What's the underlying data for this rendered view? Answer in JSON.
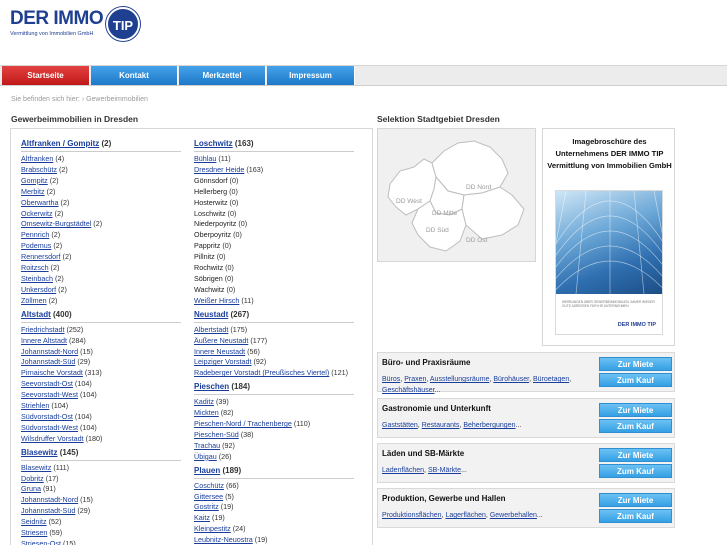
{
  "logo": {
    "name": "DER IMMO",
    "badge": "TIP",
    "tagline": "Vermittlung von Immobilien GmbH"
  },
  "nav": [
    "Startseite",
    "Kontakt",
    "Merkzettel",
    "Impressum"
  ],
  "breadcrumb": "Sie befinden sich hier:  ›  Gewerbeimmobilien",
  "left": {
    "title": "Gewerbeimmobilien in Dresden",
    "col1": [
      {
        "name": "Altfranken / Gompitz",
        "count": "(2)",
        "items": [
          [
            "Altfranken",
            "(4)",
            true
          ],
          [
            "Brabschütz",
            "(2)",
            true
          ],
          [
            "Gompitz",
            "(2)",
            true
          ],
          [
            "Merbitz",
            "(2)",
            true
          ],
          [
            "Oberwartha",
            "(2)",
            true
          ],
          [
            "Ockerwitz",
            "(2)",
            true
          ],
          [
            "Omsewitz-Burgstädtel",
            "(2)",
            true
          ],
          [
            "Pennrich",
            "(2)",
            true
          ],
          [
            "Podemus",
            "(2)",
            true
          ],
          [
            "Rennersdorf",
            "(2)",
            true
          ],
          [
            "Roitzsch",
            "(2)",
            true
          ],
          [
            "Steinbach",
            "(2)",
            true
          ],
          [
            "Unkersdorf",
            "(2)",
            true
          ],
          [
            "Zöllmen",
            "(2)",
            true
          ]
        ]
      },
      {
        "name": "Altstadt",
        "count": "(400)",
        "items": [
          [
            "Friedrichstadt",
            "(252)",
            true
          ],
          [
            "Innere Altstadt",
            "(284)",
            true
          ],
          [
            "Johannstadt-Nord",
            "(15)",
            true
          ],
          [
            "Johannstadt-Süd",
            "(29)",
            true
          ],
          [
            "Pirnaische Vorstadt",
            "(313)",
            true
          ],
          [
            "Seevorstadt-Ost",
            "(104)",
            true
          ],
          [
            "Seevorstadt-West",
            "(104)",
            true
          ],
          [
            "Striehlen",
            "(104)",
            true
          ],
          [
            "Südvorstadt-Ost",
            "(104)",
            true
          ],
          [
            "Südvorstadt-West",
            "(104)",
            true
          ],
          [
            "Wilsdruffer Vorstadt",
            "(180)",
            true
          ]
        ]
      },
      {
        "name": "Blasewitz",
        "count": "(145)",
        "items": [
          [
            "Blasewitz",
            "(111)",
            true
          ],
          [
            "Dobritz",
            "(17)",
            true
          ],
          [
            "Gruna",
            "(91)",
            true
          ],
          [
            "Johannstadt-Nord",
            "(15)",
            true
          ],
          [
            "Johannstadt-Süd",
            "(29)",
            true
          ],
          [
            "Seidnitz",
            "(52)",
            true
          ],
          [
            "Striesen",
            "(59)",
            true
          ],
          [
            "Striesen-Ost",
            "(15)",
            true
          ]
        ]
      }
    ],
    "col2": [
      {
        "name": "Loschwitz",
        "count": "(163)",
        "items": [
          [
            "Bühlau",
            "(11)",
            true
          ],
          [
            "Dresdner Heide",
            "(163)",
            true
          ],
          [
            "Gönnsdorf",
            "(0)",
            false
          ],
          [
            "Hellerberg",
            "(0)",
            false
          ],
          [
            "Hosterwitz",
            "(0)",
            false
          ],
          [
            "Loschwitz",
            "(0)",
            false
          ],
          [
            "Niederpoyritz",
            "(0)",
            false
          ],
          [
            "Oberpoyritz",
            "(0)",
            false
          ],
          [
            "Pappritz",
            "(0)",
            false
          ],
          [
            "Pillnitz",
            "(0)",
            false
          ],
          [
            "Rochwitz",
            "(0)",
            false
          ],
          [
            "Söbrigen",
            "(0)",
            false
          ],
          [
            "Wachwitz",
            "(0)",
            false
          ],
          [
            "Weißer Hirsch",
            "(11)",
            true
          ]
        ]
      },
      {
        "name": "Neustadt",
        "count": "(267)",
        "items": [
          [
            "Albertstadt",
            "(175)",
            true
          ],
          [
            "Äußere Neustadt",
            "(177)",
            true
          ],
          [
            "Innere Neustadt",
            "(56)",
            true
          ],
          [
            "Leipziger Vorstadt",
            "(92)",
            true
          ],
          [
            "Radeberger Vorstadt (Preußisches Viertel)",
            "(121)",
            true
          ]
        ]
      },
      {
        "name": "Pieschen",
        "count": "(184)",
        "items": [
          [
            "Kaditz",
            "(39)",
            true
          ],
          [
            "Mickten",
            "(82)",
            true
          ],
          [
            "Pieschen-Nord / Trachenberge",
            "(110)",
            true
          ],
          [
            "Pieschen-Süd",
            "(38)",
            true
          ],
          [
            "Trachau",
            "(92)",
            true
          ],
          [
            "Übigau",
            "(26)",
            true
          ]
        ]
      },
      {
        "name": "Plauen",
        "count": "(189)",
        "items": [
          [
            "Coschütz",
            "(66)",
            true
          ],
          [
            "Gittersee",
            "(5)",
            true
          ],
          [
            "Gostritz",
            "(19)",
            true
          ],
          [
            "Kaitz",
            "(19)",
            true
          ],
          [
            "Kleinpestitz",
            "(24)",
            true
          ],
          [
            "Leubnitz-Neuostra",
            "(19)",
            true
          ]
        ]
      }
    ]
  },
  "map": {
    "title": "Selektion Stadtgebiet Dresden",
    "labels": {
      "nord": "DD Nord",
      "west": "DD West",
      "mitte": "DD Mitte",
      "sued": "DD Süd",
      "ost": "DD Ost"
    }
  },
  "brochure": {
    "title": "Imagebroschüre des Unternehmens DER IMMO TIP Vermittlung von Immobilien GmbH",
    "cover_text": "WERBUNGEN ÜBER GEWERBEIMMOBILIEN. IMMER WIEDER GUTE ADRESSEN FÜR IHR UNTERNEHMEN",
    "cover_logo": "DER IMMO TIP"
  },
  "categories": [
    {
      "title": "Büro- und Praxisräume",
      "links": [
        "Büros",
        "Praxen",
        "Ausstellungsräume",
        "Bürohäuser",
        "Büroetagen",
        "Geschäftshäuser"
      ],
      "rent": "Zur Miete",
      "buy": "Zum Kauf"
    },
    {
      "title": "Gastronomie und Unterkunft",
      "links": [
        "Gaststätten",
        "Restaurants",
        "Beherbergungen"
      ],
      "rent": "Zur Miete",
      "buy": "Zum Kauf"
    },
    {
      "title": "Läden und SB-Märkte",
      "links": [
        "Ladenflächen",
        "SB-Märkte"
      ],
      "rent": "Zur Miete",
      "buy": "Zum Kauf"
    },
    {
      "title": "Produktion, Gewerbe und Hallen",
      "links": [
        "Produktionsflächen",
        "Lagerflächen",
        "Gewerbehallen"
      ],
      "rent": "Zur Miete",
      "buy": "Zum Kauf"
    }
  ]
}
